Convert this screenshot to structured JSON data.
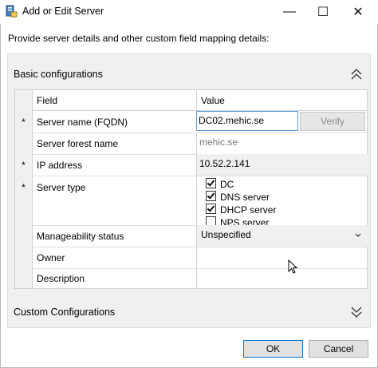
{
  "window": {
    "title": "Add or Edit Server",
    "icon": "server-icon"
  },
  "title_controls": {
    "minimize": "—",
    "maximize": "☐",
    "close": "✕"
  },
  "intro_text": "Provide server details and other custom field mapping details:",
  "basic": {
    "title": "Basic configurations",
    "collapse_icon": "chevron-double-up-icon",
    "headers": {
      "field": "Field",
      "value": "Value"
    },
    "rows": {
      "server_name": {
        "marker": "*",
        "label": "Server name (FQDN)",
        "value": "DC02.mehic.se",
        "verify": "Verify"
      },
      "forest": {
        "marker": "",
        "label": "Server forest name",
        "value": "mehic.se"
      },
      "ip": {
        "marker": "*",
        "label": "IP address",
        "value": "10.52.2.141"
      },
      "server_type": {
        "marker": "*",
        "label": "Server type",
        "options": [
          {
            "label": "DC",
            "checked": true
          },
          {
            "label": "DNS server",
            "checked": true
          },
          {
            "label": "DHCP server",
            "checked": true
          },
          {
            "label": "NPS server",
            "checked": false
          }
        ]
      },
      "manageability": {
        "label": "Manageability status",
        "value": "Unspecified",
        "dropdown_icon": "chevron-down-icon"
      },
      "owner": {
        "label": "Owner",
        "value": ""
      },
      "description": {
        "label": "Description",
        "value": ""
      }
    }
  },
  "custom": {
    "title": "Custom Configurations",
    "expand_icon": "chevron-double-down-icon"
  },
  "buttons": {
    "ok": "OK",
    "cancel": "Cancel"
  },
  "cursor": "mouse-pointer-icon"
}
